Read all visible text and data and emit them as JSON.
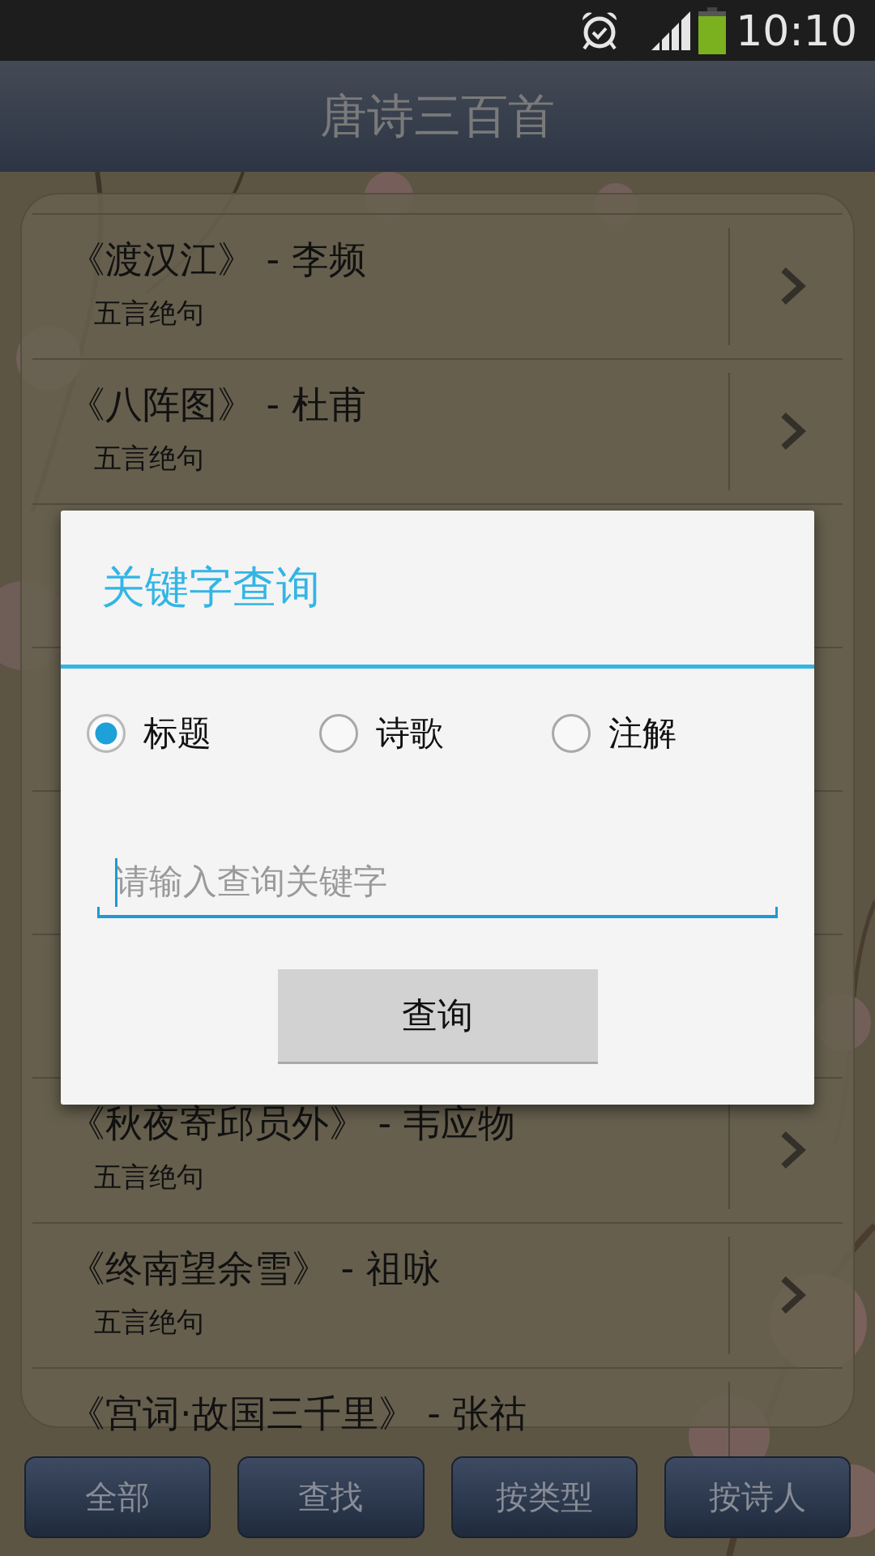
{
  "status_bar": {
    "time": "10:10"
  },
  "title": "唐诗三百首",
  "poem_list": {
    "top_rows": [
      {
        "title": "《渡汉江》 - 李频",
        "type": "五言绝句"
      },
      {
        "title": "《八阵图》 - 杜甫",
        "type": "五言绝句"
      }
    ],
    "bottom_rows": [
      {
        "title": "《秋夜寄邱员外》 - 韦应物",
        "type": "五言绝句"
      },
      {
        "title": "《终南望余雪》 - 祖咏",
        "type": "五言绝句"
      },
      {
        "title": "《宫词·故国三千里》 - 张祜"
      }
    ]
  },
  "dialog": {
    "title": "关键字查询",
    "options": [
      {
        "label": "标题",
        "selected": true
      },
      {
        "label": "诗歌",
        "selected": false
      },
      {
        "label": "注解",
        "selected": false
      }
    ],
    "search": {
      "placeholder": "请输入查询关键字"
    },
    "button": "查询"
  },
  "tabs": [
    {
      "label": "全部"
    },
    {
      "label": "查找"
    },
    {
      "label": "按类型"
    },
    {
      "label": "按诗人"
    }
  ]
}
